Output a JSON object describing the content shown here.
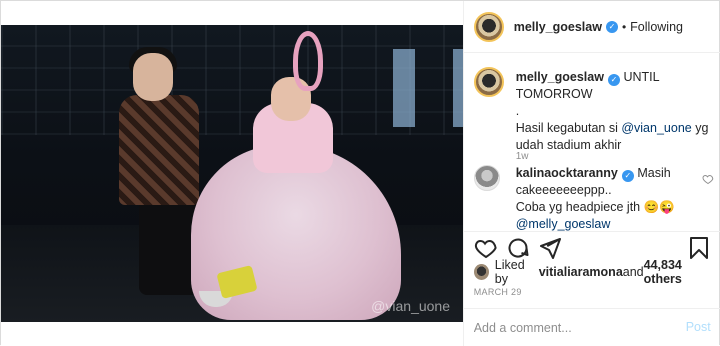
{
  "post": {
    "media": {
      "watermark": "@vian_uone"
    },
    "header": {
      "username": "melly_goeslaw",
      "verified_icon": "verified-badge-icon",
      "separator": "•",
      "follow_status": "Following"
    },
    "caption": {
      "username": "melly_goeslaw",
      "line1": "UNTIL TOMORROW",
      "line2": ".",
      "text_before_mention": "Hasil kegabutan si ",
      "mention": "@vian_uone",
      "text_after_mention": " yg udah stadium akhir",
      "time_ago": "1w"
    },
    "comment": {
      "username": "kalinaocktaranny",
      "text1": "Masih cakeeeeeeeppp..",
      "text2": "Coba yg headpiece jth 😊😜",
      "mention": "@melly_goeslaw"
    },
    "actions": {
      "like_icon": "heart-icon",
      "comment_icon": "comment-icon",
      "share_icon": "share-icon",
      "save_icon": "bookmark-icon"
    },
    "likes": {
      "prefix": "Liked by ",
      "user": "vitialiaramona",
      "middle": " and ",
      "count": "44,834 others"
    },
    "date": "MARCH 29",
    "add_comment": {
      "placeholder": "Add a comment...",
      "post_label": "Post"
    }
  },
  "colors": {
    "accent_blue": "#3897f0",
    "mention": "#00376b",
    "muted": "#8e8e8e",
    "post_disabled": "#b2dffc"
  }
}
